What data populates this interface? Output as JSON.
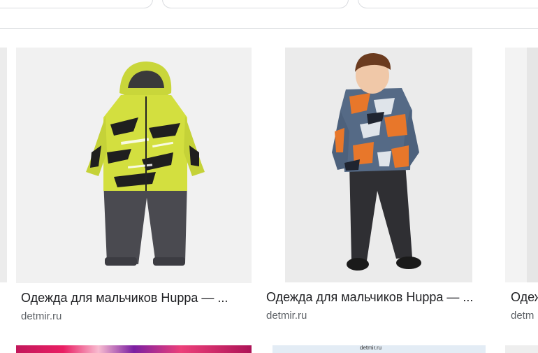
{
  "results": [
    {
      "title": "Одежда для мальчиков Huppa — ...",
      "source": "detmir.ru"
    },
    {
      "title": "Одежда для мальчиков Huppa — ...",
      "source": "detmir.ru"
    },
    {
      "title": "Одеж",
      "source": "detm"
    }
  ],
  "bottom_row": {
    "watermark": "detmir.ru"
  }
}
